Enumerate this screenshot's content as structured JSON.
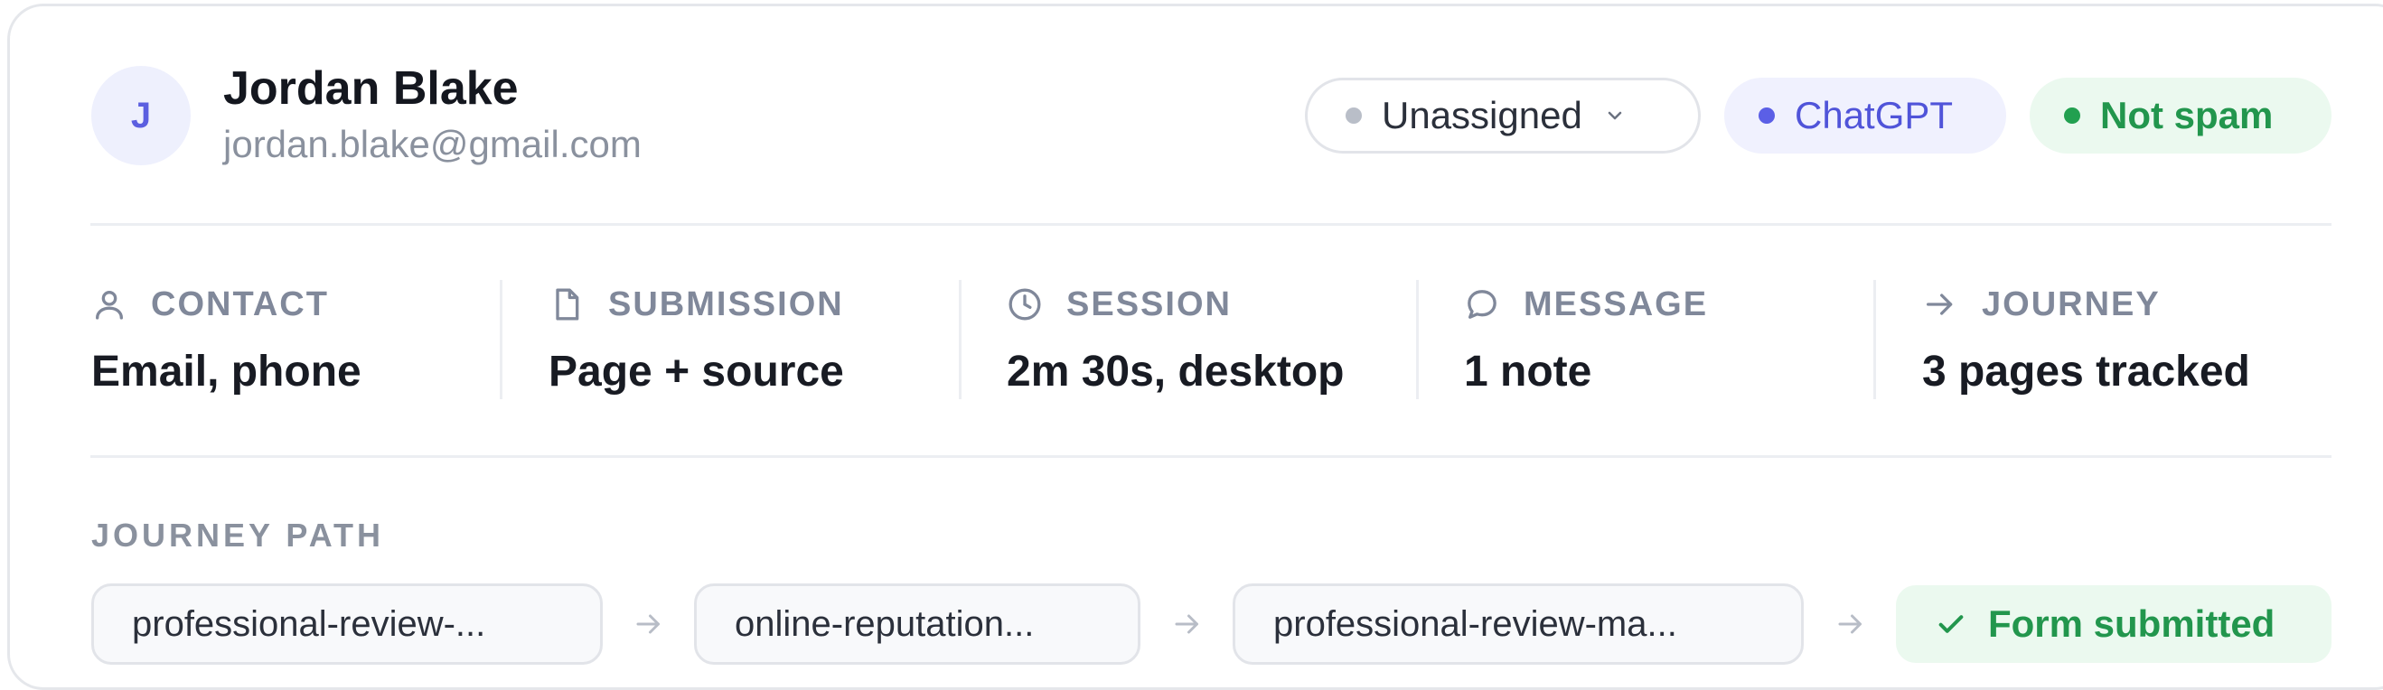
{
  "lead": {
    "initial": "J",
    "name": "Jordan Blake",
    "email": "jordan.blake@gmail.com"
  },
  "badges": {
    "assignee": "Unassigned",
    "source": "ChatGPT",
    "spam_status": "Not spam"
  },
  "stats": [
    {
      "icon": "user-icon",
      "label": "CONTACT",
      "value": "Email, phone"
    },
    {
      "icon": "document-icon",
      "label": "SUBMISSION",
      "value": "Page + source"
    },
    {
      "icon": "clock-icon",
      "label": "SESSION",
      "value": "2m 30s, desktop"
    },
    {
      "icon": "message-icon",
      "label": "MESSAGE",
      "value": "1 note"
    },
    {
      "icon": "arrow-right-icon",
      "label": "JOURNEY",
      "value": "3 pages tracked"
    }
  ],
  "journey": {
    "label": "JOURNEY PATH",
    "steps": [
      "professional-review-...",
      "online-reputation...",
      "professional-review-ma..."
    ],
    "final": "Form submitted"
  },
  "colors": {
    "accent": "#5b5fe6",
    "success": "#22964d",
    "muted": "#8a919e"
  }
}
